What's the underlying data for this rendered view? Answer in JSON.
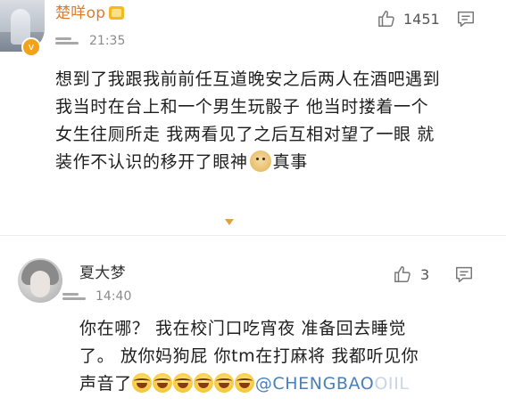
{
  "comments": [
    {
      "username": "楚咩op",
      "badge_icon": "vip-crown-icon",
      "avatar_badge_icon": "v-verified-icon",
      "time": "21:35",
      "likes": "1451",
      "lines": [
        "想到了我跟我前前任互道晚安之后两人在酒吧遇到",
        "我当时在台上和一个男生玩骰子 他当时搂着一个",
        "女生往厕所走 我两看见了之后互相对望了一眼 就",
        "装作不认识的移开了眼神"
      ],
      "line4_suffix": "真事",
      "emoji_icon": "doge-emoji-icon"
    },
    {
      "username": "夏大梦",
      "time": "14:40",
      "likes": "3",
      "lines": [
        "你在哪？  我在校门口吃宵夜 准备回去睡觉",
        "了。 放你妈狗屁 你tm在打麻将 我都听见你",
        "声音了"
      ],
      "mention_visible": "@CHENGBAO",
      "mention_faded": "OIIL",
      "emoji_icon": "laughing-crying-emoji-icon"
    }
  ],
  "colors": {
    "username_highlight": "#e07b2c",
    "mention": "#4a7fb8",
    "expand_arrow": "#e0a23a"
  },
  "icons": {
    "like": "thumbs-up-icon",
    "reply": "comment-bubble-icon",
    "expand": "expand-triangle-icon",
    "device": "phone-client-icon"
  }
}
